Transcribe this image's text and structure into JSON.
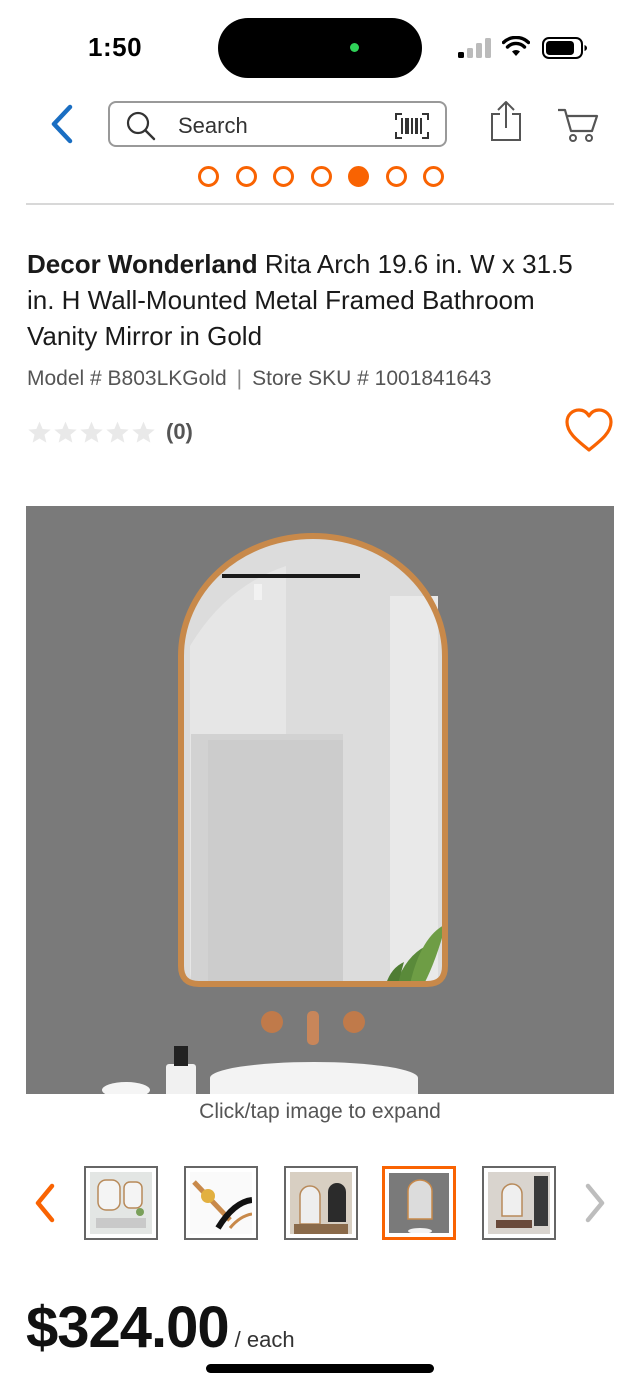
{
  "status_bar": {
    "time": "1:50",
    "icons": [
      "signal-icon",
      "wifi-icon",
      "battery-icon"
    ]
  },
  "header": {
    "search_placeholder": "Search",
    "icons": [
      "back-chevron-icon",
      "search-icon",
      "barcode-icon",
      "share-icon",
      "cart-icon"
    ]
  },
  "carousel": {
    "dot_count": 7,
    "active_index": 4
  },
  "product": {
    "brand": "Decor Wonderland",
    "name": "Rita Arch 19.6 in. W x 31.5 in. H Wall-Mounted Metal Framed Bathroom Vanity Mirror in Gold",
    "model": "Model # B803LKGold",
    "separator": "|",
    "sku": "Store SKU # 1001841643",
    "rating": {
      "stars": 0,
      "max_stars": 5,
      "count": "(0)"
    },
    "expand_hint": "Click/tap image to expand",
    "thumbnails": [
      "thumbnail-1",
      "thumbnail-2",
      "thumbnail-3",
      "thumbnail-4",
      "thumbnail-5"
    ],
    "active_thumbnail": 3,
    "price": "$324.00",
    "price_unit": "/ each"
  },
  "colors": {
    "accent": "#f96302",
    "link_blue": "#1a6ec2",
    "wall_gray": "#7a7a7a",
    "frame_gold": "#c8894a"
  }
}
